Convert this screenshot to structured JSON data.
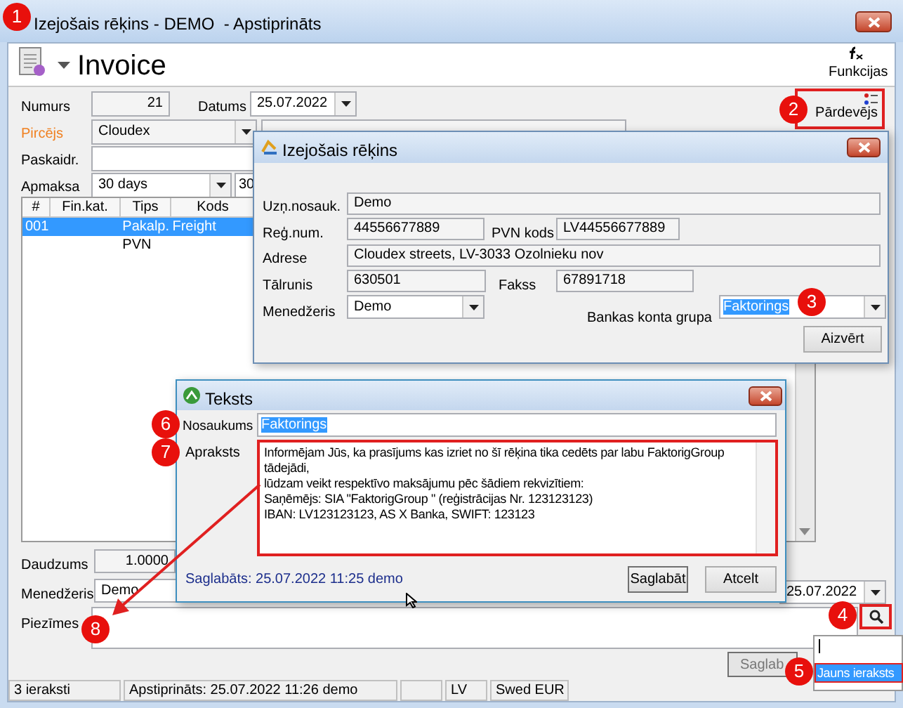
{
  "window": {
    "title": "Izejošais rēķins - DEMO  - Apstiprināts"
  },
  "toolbar": {
    "title": "Invoice",
    "functions": "Funkcijas",
    "seller_button": "Pārdevējs"
  },
  "form": {
    "number": {
      "label": "Numurs",
      "value": "21"
    },
    "date": {
      "label": "Datums",
      "value": "25.07.2022"
    },
    "buyer": {
      "label": "Pircējs",
      "value": "Cloudex",
      "required": true
    },
    "note": {
      "label": "Paskaidr."
    },
    "payment": {
      "label": "Apmaksa",
      "value": "30 days",
      "days": "30"
    }
  },
  "table": {
    "columns": [
      "#",
      "Fin.kat.",
      "Tips",
      "Kods"
    ],
    "rows": [
      {
        "number": "001",
        "type": "Pakalp.",
        "code": "Freight",
        "selected": true
      },
      {
        "type": "PVN",
        "selected": false
      }
    ]
  },
  "bottom": {
    "quantity": {
      "label": "Daudzums",
      "value": "1.0000"
    },
    "manager": {
      "label": "Menedžeris",
      "value": "Demo"
    },
    "date": "25.07.2022",
    "notes": {
      "label": "Piezīmes"
    },
    "save_button": "Saglab"
  },
  "popup": {
    "items": [
      {
        "label": "Jauns ieraksts",
        "selected": true
      }
    ]
  },
  "status_bar": {
    "records": "3 ieraksti",
    "approved": "Apstiprināts: 25.07.2022 11:26 demo",
    "language": "LV",
    "bank": "Swed EUR"
  },
  "seller_dialog": {
    "title": "Izejošais rēķins",
    "company": {
      "label": "Uzņ.nosauk.",
      "value": "Demo"
    },
    "reg_number": {
      "label": "Reģ.num.",
      "value": "44556677889"
    },
    "vat_code": {
      "label": "PVN kods",
      "value": "LV44556677889"
    },
    "address": {
      "label": "Adrese",
      "value": "Cloudex streets, LV-3033 Ozolnieku nov"
    },
    "phone": {
      "label": "Tālrunis",
      "value": "630501"
    },
    "fax": {
      "label": "Fakss",
      "value": "67891718"
    },
    "manager": {
      "label": "Menedžeris",
      "value": "Demo"
    },
    "bank_group": {
      "label": "Bankas konta grupa",
      "value": "Faktorings",
      "text_selected": true
    },
    "close_button": "Aizvērt"
  },
  "text_dialog": {
    "title": "Teksts",
    "name": {
      "label": "Nosaukums",
      "value": "Faktorings",
      "text_selected": true
    },
    "description": {
      "label": "Apraksts",
      "value": "Informējam Jūs, ka prasījums kas izriet no šī rēķina tika cedēts par labu FaktorigGroup tādejādi,\nlūdzam veikt respektīvo maksājumu pēc šādiem rekvizītiem:\nSaņēmējs: SIA \"FaktorigGroup \" (reģistrācijas Nr. 123123123)\nIBAN: LV123123123, AS X Banka, SWIFT: 123123"
    },
    "saved": "Saglabāts: 25.07.2022 11:25 demo",
    "save_button": "Saglabāt",
    "cancel_button": "Atcelt"
  },
  "markers": [
    "1",
    "2",
    "3",
    "4",
    "5",
    "6",
    "7",
    "8"
  ]
}
